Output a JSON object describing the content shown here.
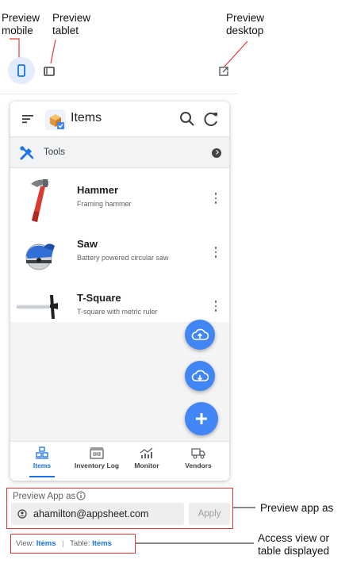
{
  "callouts": {
    "preview_mobile": [
      "Preview",
      "mobile"
    ],
    "preview_tablet": [
      "Preview",
      "tablet"
    ],
    "preview_desktop": [
      "Preview",
      "desktop"
    ],
    "preview_app_as": "Preview app as",
    "access_view": [
      "Access view or",
      "table displayed"
    ]
  },
  "app": {
    "title": "Items",
    "group": "Tools",
    "rows": [
      {
        "title": "Hammer",
        "subtitle": "Framing hammer"
      },
      {
        "title": "Saw",
        "subtitle": "Battery powered circular saw"
      },
      {
        "title": "T-Square",
        "subtitle": "T-square with metric ruler"
      }
    ],
    "nav": [
      {
        "label": "Items",
        "active": true,
        "icon": "boxes-icon"
      },
      {
        "label": "Inventory Log",
        "active": false,
        "icon": "warehouse-icon"
      },
      {
        "label": "Monitor",
        "active": false,
        "icon": "chart-icon"
      },
      {
        "label": "Vendors",
        "active": false,
        "icon": "truck-icon"
      }
    ]
  },
  "preview_as": {
    "label": "Preview App as",
    "email": "ahamilton@appsheet.com",
    "apply_label": "Apply"
  },
  "view_info": {
    "view_label": "View:",
    "view_value": "Items",
    "separator": "|",
    "table_label": "Table:",
    "table_value": "Items"
  },
  "colors": {
    "accent": "#4285f4",
    "link": "#1a73e8",
    "callout_border": "#e53935"
  }
}
